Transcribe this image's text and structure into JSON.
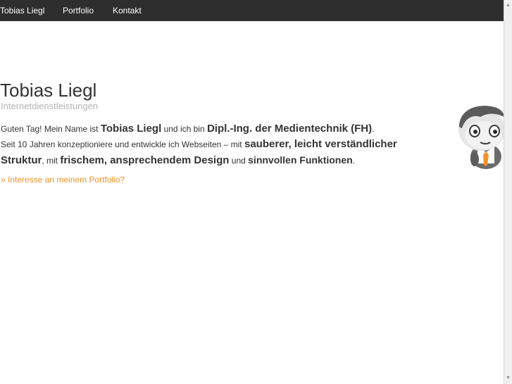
{
  "nav": {
    "brand": "Tobias Liegl",
    "items": [
      {
        "label": "Portfolio"
      },
      {
        "label": "Kontakt"
      }
    ]
  },
  "header": {
    "title": "Tobias Liegl",
    "subtitle": "Internetdienstleistungen"
  },
  "intro": {
    "greeting": "Guten Tag! Mein Name ist ",
    "name": "Tobias Liegl",
    "and_i_am": " und ich bin ",
    "degree": "Dipl.-Ing. der Medientechnik (FH)",
    "period1": ".",
    "since": "Seit 10 Jahren konzeptioniere und entwickle ich Webseiten – mit ",
    "highlight1": "sauberer, leicht verständlicher Struktur",
    "with": ", mit ",
    "highlight2": "frischem, ansprechendem Design",
    "and": " und ",
    "highlight3": "sinnvollen Funktionen",
    "period2": "."
  },
  "cta": {
    "label": "» Interesse an meinem Portfolio?"
  },
  "colors": {
    "topbar": "#2e2e2e",
    "accent": "#f0932b",
    "subtitle": "#b3b3b3",
    "text": "#333333"
  },
  "icons": {
    "mascot": "cartoon-character-icon"
  }
}
